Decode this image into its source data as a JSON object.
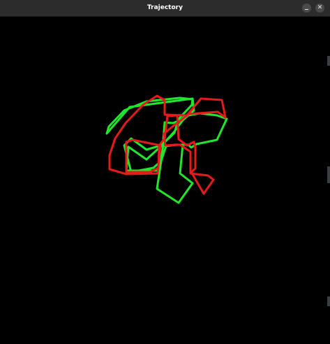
{
  "window": {
    "title": "Trajectory",
    "minimize_glyph": "",
    "close_glyph": "✕"
  },
  "colors": {
    "background": "#000000",
    "titlebar": "#2c2c2c",
    "trajectory_a": "#00e000",
    "trajectory_b": "#e00000"
  },
  "trajectories": [
    {
      "name": "green",
      "color": "#21e62e",
      "points": [
        [
          153,
          191
        ],
        [
          186,
          153
        ],
        [
          276,
          141
        ],
        [
          278,
          158
        ],
        [
          262,
          172
        ],
        [
          250,
          188
        ],
        [
          232,
          208
        ],
        [
          210,
          228
        ],
        [
          184,
          210
        ],
        [
          181,
          244
        ],
        [
          227,
          244
        ],
        [
          234,
          209
        ],
        [
          252,
          207
        ],
        [
          270,
          207
        ],
        [
          274,
          211
        ],
        [
          282,
          206
        ],
        [
          311,
          200
        ],
        [
          325,
          170
        ],
        [
          311,
          165
        ],
        [
          286,
          162
        ],
        [
          265,
          166
        ],
        [
          258,
          172
        ],
        [
          248,
          176
        ],
        [
          236,
          175
        ],
        [
          234,
          201
        ],
        [
          232,
          224
        ],
        [
          225,
          270
        ],
        [
          256,
          290
        ],
        [
          276,
          262
        ],
        [
          258,
          248
        ],
        [
          262,
          207
        ],
        [
          252,
          207
        ],
        [
          238,
          209
        ],
        [
          231,
          230
        ],
        [
          220,
          240
        ],
        [
          188,
          246
        ],
        [
          178,
          208
        ],
        [
          188,
          198
        ],
        [
          210,
          214
        ],
        [
          231,
          208
        ],
        [
          250,
          190
        ],
        [
          256,
          170
        ],
        [
          275,
          150
        ],
        [
          276,
          142
        ],
        [
          258,
          140
        ],
        [
          210,
          145
        ],
        [
          178,
          158
        ],
        [
          156,
          181
        ],
        [
          153,
          191
        ]
      ]
    },
    {
      "name": "red",
      "color": "#e61a1a",
      "points": [
        [
          157,
          242
        ],
        [
          181,
          249
        ],
        [
          226,
          248
        ],
        [
          230,
          208
        ],
        [
          190,
          200
        ],
        [
          181,
          203
        ],
        [
          181,
          246
        ],
        [
          215,
          246
        ],
        [
          227,
          240
        ],
        [
          228,
          208
        ],
        [
          236,
          198
        ],
        [
          240,
          166
        ],
        [
          254,
          165
        ],
        [
          256,
          199
        ],
        [
          268,
          208
        ],
        [
          278,
          203
        ],
        [
          280,
          211
        ],
        [
          280,
          241
        ],
        [
          274,
          246
        ],
        [
          292,
          277
        ],
        [
          306,
          257
        ],
        [
          298,
          251
        ],
        [
          273,
          248
        ],
        [
          273,
          217
        ],
        [
          258,
          207
        ],
        [
          237,
          208
        ],
        [
          235,
          191
        ],
        [
          246,
          182
        ],
        [
          271,
          163
        ],
        [
          312,
          160
        ],
        [
          323,
          168
        ],
        [
          318,
          143
        ],
        [
          288,
          141
        ],
        [
          268,
          165
        ],
        [
          236,
          164
        ],
        [
          236,
          143
        ],
        [
          225,
          137
        ],
        [
          205,
          150
        ],
        [
          180,
          176
        ],
        [
          165,
          198
        ],
        [
          157,
          222
        ],
        [
          157,
          242
        ]
      ]
    }
  ]
}
